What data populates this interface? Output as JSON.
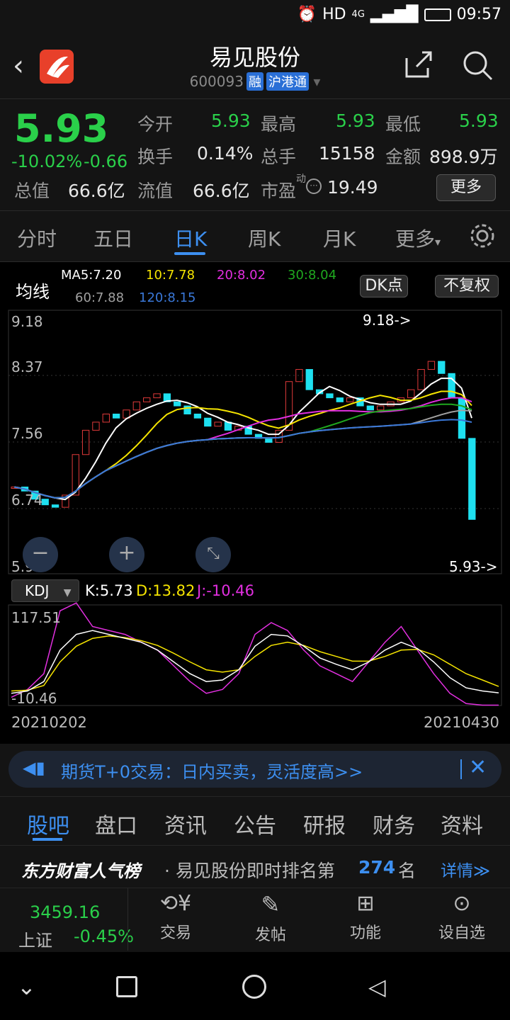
{
  "status": {
    "network": "HD",
    "signal_label": "4G",
    "time": "09:57"
  },
  "header": {
    "title": "易见股份",
    "code": "600093",
    "badge1": "融",
    "badge2": "沪港通"
  },
  "quote": {
    "price": "5.93",
    "change_pct": "-10.02%",
    "change_amt": "-0.66",
    "total_value_label": "总值",
    "total_value": "66.6亿",
    "open_label": "今开",
    "open": "5.93",
    "high_label": "最高",
    "high": "5.93",
    "low_label": "最低",
    "low": "5.93",
    "turnover_label": "换手",
    "turnover": "0.14%",
    "volume_label": "总手",
    "volume": "15158",
    "amount_label": "金额",
    "amount": "898.9万",
    "float_label": "流值",
    "float_value": "66.6亿",
    "pe_label": "市盈",
    "pe_sup": "动",
    "pe": "19.49",
    "more_btn": "更多"
  },
  "tabs": [
    "分时",
    "五日",
    "日K",
    "周K",
    "月K",
    "更多"
  ],
  "chart": {
    "ma_label": "均线",
    "ma5": "MA5:7.20",
    "ma10": "10:7.78",
    "ma20": "20:8.02",
    "ma30": "30:8.04",
    "ma60": "60:7.88",
    "ma120": "120:8.15",
    "dk_btn": "DK点",
    "fq_btn": "不复权",
    "y_labels": [
      "9.18",
      "8.37",
      "7.56",
      "6.74",
      "5.93"
    ],
    "max_marker": "9.18->",
    "min_marker": "5.93->",
    "kdj_select": "KDJ",
    "k_val": "K:5.73",
    "d_val": "D:13.82",
    "j_val": "J:-10.46",
    "kdj_top": "117.51",
    "kdj_bottom": "-10.46",
    "date_start": "20210202",
    "date_end": "20210430",
    "colors": {
      "ma5": "#ffffff",
      "ma10": "#f5e400",
      "ma20": "#e22fe0",
      "ma30": "#1fa81f",
      "ma60": "#a0a0a0",
      "ma120": "#3a78d8",
      "up": "#e03a3a",
      "down": "#1ee0f0"
    }
  },
  "chart_data": {
    "type": "candlestick",
    "title": "",
    "ylim": [
      5.93,
      9.18
    ],
    "x_range": [
      "20210202",
      "20210430"
    ],
    "series": [
      {
        "name": "MA5",
        "value": 7.2
      },
      {
        "name": "MA10",
        "value": 7.78
      },
      {
        "name": "MA20",
        "value": 8.02
      },
      {
        "name": "MA30",
        "value": 8.04
      },
      {
        "name": "MA60",
        "value": 7.88
      },
      {
        "name": "MA120",
        "value": 8.15
      }
    ],
    "kdj": {
      "K": 5.73,
      "D": 13.82,
      "J": -10.46,
      "ylim": [
        -10.46,
        117.51
      ]
    }
  },
  "promo": {
    "text": "期货T+0交易：日内买卖，灵活度高>>"
  },
  "bottom_tabs": [
    "股吧",
    "盘口",
    "资讯",
    "公告",
    "研报",
    "财务",
    "资料"
  ],
  "rank": {
    "brand": "东方财富人气榜",
    "text_prefix": "· 易见股份即时排名第",
    "rank": "274",
    "text_suffix": "名",
    "detail": "详情≫"
  },
  "toolbar": {
    "index_value": "3459.16",
    "index_name": "上证",
    "index_change": "-0.45%",
    "items": [
      "交易",
      "发帖",
      "功能",
      "设自选"
    ]
  }
}
